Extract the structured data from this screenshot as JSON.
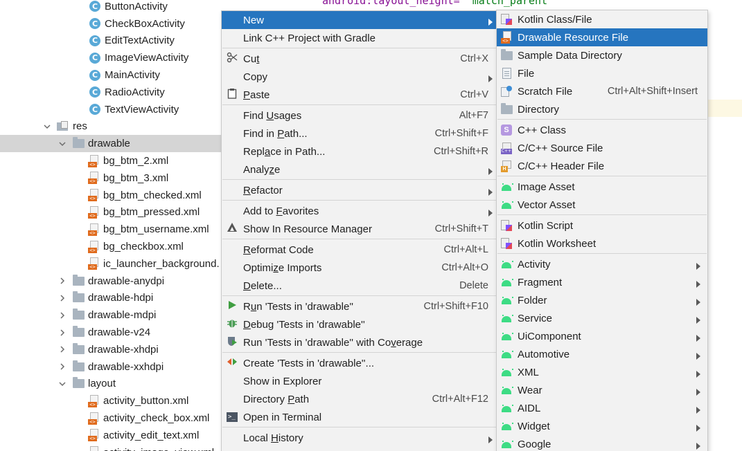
{
  "editor": {
    "code_attr": "android:layout_height=",
    "code_value": "\"match_parent\""
  },
  "tree": {
    "rows": [
      {
        "label": "ButtonActivity",
        "icon": "class-icon",
        "indent": 130,
        "arrow": ""
      },
      {
        "label": "CheckBoxActivity",
        "icon": "class-icon",
        "indent": 130,
        "arrow": ""
      },
      {
        "label": "EditTextActivity",
        "icon": "class-icon",
        "indent": 130,
        "arrow": ""
      },
      {
        "label": "ImageViewActivity",
        "icon": "class-icon",
        "indent": 130,
        "arrow": ""
      },
      {
        "label": "MainActivity",
        "icon": "class-icon",
        "indent": 130,
        "arrow": ""
      },
      {
        "label": "RadioActivity",
        "icon": "class-icon",
        "indent": 130,
        "arrow": ""
      },
      {
        "label": "TextViewActivity",
        "icon": "class-icon",
        "indent": 130,
        "arrow": ""
      },
      {
        "label": "res",
        "icon": "res-folder-icon",
        "indent": 84,
        "arrow": "down"
      },
      {
        "label": "drawable",
        "icon": "folder-icon",
        "indent": 106,
        "arrow": "down",
        "selected": true
      },
      {
        "label": "bg_btm_2.xml",
        "icon": "xml-file-icon",
        "indent": 128,
        "arrow": ""
      },
      {
        "label": "bg_btm_3.xml",
        "icon": "xml-file-icon",
        "indent": 128,
        "arrow": ""
      },
      {
        "label": "bg_btm_checked.xml",
        "icon": "xml-file-icon",
        "indent": 128,
        "arrow": ""
      },
      {
        "label": "bg_btm_pressed.xml",
        "icon": "xml-file-icon",
        "indent": 128,
        "arrow": ""
      },
      {
        "label": "bg_btm_username.xml",
        "icon": "xml-file-icon",
        "indent": 128,
        "arrow": ""
      },
      {
        "label": "bg_checkbox.xml",
        "icon": "xml-file-icon",
        "indent": 128,
        "arrow": ""
      },
      {
        "label": "ic_launcher_background.",
        "icon": "xml-file-icon",
        "indent": 128,
        "arrow": ""
      },
      {
        "label": "drawable-anydpi",
        "icon": "folder-icon",
        "indent": 106,
        "arrow": "right"
      },
      {
        "label": "drawable-hdpi",
        "icon": "folder-icon",
        "indent": 106,
        "arrow": "right"
      },
      {
        "label": "drawable-mdpi",
        "icon": "folder-icon",
        "indent": 106,
        "arrow": "right"
      },
      {
        "label": "drawable-v24",
        "icon": "folder-icon",
        "indent": 106,
        "arrow": "right"
      },
      {
        "label": "drawable-xhdpi",
        "icon": "folder-icon",
        "indent": 106,
        "arrow": "right"
      },
      {
        "label": "drawable-xxhdpi",
        "icon": "folder-icon",
        "indent": 106,
        "arrow": "right"
      },
      {
        "label": "layout",
        "icon": "folder-icon",
        "indent": 106,
        "arrow": "down"
      },
      {
        "label": "activity_button.xml",
        "icon": "xml-file-icon",
        "indent": 128,
        "arrow": ""
      },
      {
        "label": "activity_check_box.xml",
        "icon": "xml-file-icon",
        "indent": 128,
        "arrow": ""
      },
      {
        "label": "activity_edit_text.xml",
        "icon": "xml-file-icon",
        "indent": 128,
        "arrow": ""
      },
      {
        "label": "activity_image_view.xml",
        "icon": "xml-file-icon",
        "indent": 128,
        "arrow": ""
      }
    ]
  },
  "context_menu": {
    "items": [
      {
        "label": "New",
        "mnemonic": "",
        "shortcut": "",
        "submenu": true,
        "highlighted": true,
        "icon": ""
      },
      {
        "label": "Link C++ Project with Gradle",
        "mnemonic": "",
        "shortcut": "",
        "icon": ""
      },
      {
        "sep": true
      },
      {
        "label": "Cut",
        "mnemonic": "t",
        "shortcut": "Ctrl+X",
        "icon": "scissors-icon"
      },
      {
        "label": "Copy",
        "mnemonic": "",
        "shortcut": "",
        "submenu": true,
        "icon": ""
      },
      {
        "label": "Paste",
        "mnemonic": "P",
        "shortcut": "Ctrl+V",
        "icon": "clipboard-icon"
      },
      {
        "sep": true
      },
      {
        "label": "Find Usages",
        "mnemonic": "U",
        "shortcut": "Alt+F7",
        "icon": ""
      },
      {
        "label": "Find in Path...",
        "mnemonic": "P",
        "shortcut": "Ctrl+Shift+F",
        "icon": ""
      },
      {
        "label": "Replace in Path...",
        "mnemonic": "a",
        "shortcut": "Ctrl+Shift+R",
        "icon": ""
      },
      {
        "label": "Analyze",
        "mnemonic": "z",
        "shortcut": "",
        "submenu": true,
        "icon": ""
      },
      {
        "sep": true
      },
      {
        "label": "Refactor",
        "mnemonic": "R",
        "shortcut": "",
        "submenu": true,
        "icon": ""
      },
      {
        "sep": true
      },
      {
        "label": "Add to Favorites",
        "mnemonic": "F",
        "shortcut": "",
        "submenu": true,
        "icon": ""
      },
      {
        "label": "Show In Resource Manager",
        "mnemonic": "",
        "shortcut": "Ctrl+Shift+T",
        "icon": "resource-manager-icon"
      },
      {
        "sep": true
      },
      {
        "label": "Reformat Code",
        "mnemonic": "R",
        "shortcut": "Ctrl+Alt+L",
        "icon": ""
      },
      {
        "label": "Optimize Imports",
        "mnemonic": "z",
        "shortcut": "Ctrl+Alt+O",
        "icon": ""
      },
      {
        "label": "Delete...",
        "mnemonic": "D",
        "shortcut": "Delete",
        "icon": ""
      },
      {
        "sep": true
      },
      {
        "label": "Run 'Tests in 'drawable''",
        "mnemonic": "u",
        "shortcut": "Ctrl+Shift+F10",
        "icon": "run-icon"
      },
      {
        "label": "Debug 'Tests in 'drawable''",
        "mnemonic": "D",
        "shortcut": "",
        "icon": "debug-icon"
      },
      {
        "label": "Run 'Tests in 'drawable'' with Coverage",
        "mnemonic": "v",
        "shortcut": "",
        "icon": "coverage-icon"
      },
      {
        "sep": true
      },
      {
        "label": "Create 'Tests in 'drawable''...",
        "mnemonic": "",
        "shortcut": "",
        "icon": "create-test-icon"
      },
      {
        "label": "Show in Explorer",
        "mnemonic": "",
        "shortcut": "",
        "icon": ""
      },
      {
        "label": "Directory Path",
        "mnemonic": "P",
        "shortcut": "Ctrl+Alt+F12",
        "icon": ""
      },
      {
        "label": "Open in Terminal",
        "mnemonic": "",
        "shortcut": "",
        "icon": "terminal-icon"
      },
      {
        "sep": true
      },
      {
        "label": "Local History",
        "mnemonic": "H",
        "shortcut": "",
        "submenu": true,
        "icon": ""
      }
    ]
  },
  "new_submenu": {
    "items": [
      {
        "label": "Kotlin Class/File",
        "icon": "kotlin-file-icon",
        "shortcut": ""
      },
      {
        "label": "Drawable Resource File",
        "icon": "xml-file-icon",
        "shortcut": "",
        "highlighted": true
      },
      {
        "label": "Sample Data Directory",
        "icon": "folder-icon",
        "shortcut": ""
      },
      {
        "label": "File",
        "icon": "file-icon",
        "shortcut": ""
      },
      {
        "label": "Scratch File",
        "icon": "scratch-file-icon",
        "shortcut": "Ctrl+Alt+Shift+Insert"
      },
      {
        "label": "Directory",
        "icon": "folder-icon",
        "shortcut": ""
      },
      {
        "sep": true
      },
      {
        "label": "C++ Class",
        "icon": "cpp-class-icon",
        "shortcut": ""
      },
      {
        "label": "C/C++ Source File",
        "icon": "cpp-source-icon",
        "shortcut": ""
      },
      {
        "label": "C/C++ Header File",
        "icon": "cpp-header-icon",
        "shortcut": ""
      },
      {
        "sep": true
      },
      {
        "label": "Image Asset",
        "icon": "android-icon",
        "shortcut": ""
      },
      {
        "label": "Vector Asset",
        "icon": "android-icon",
        "shortcut": ""
      },
      {
        "sep": true
      },
      {
        "label": "Kotlin Script",
        "icon": "kotlin-script-icon",
        "shortcut": ""
      },
      {
        "label": "Kotlin Worksheet",
        "icon": "kotlin-script-icon",
        "shortcut": ""
      },
      {
        "sep": true
      },
      {
        "label": "Activity",
        "icon": "android-icon",
        "submenu": true
      },
      {
        "label": "Fragment",
        "icon": "android-icon",
        "submenu": true
      },
      {
        "label": "Folder",
        "icon": "android-icon",
        "submenu": true
      },
      {
        "label": "Service",
        "icon": "android-icon",
        "submenu": true
      },
      {
        "label": "UiComponent",
        "icon": "android-icon",
        "submenu": true
      },
      {
        "label": "Automotive",
        "icon": "android-icon",
        "submenu": true
      },
      {
        "label": "XML",
        "icon": "android-icon",
        "submenu": true
      },
      {
        "label": "Wear",
        "icon": "android-icon",
        "submenu": true
      },
      {
        "label": "AIDL",
        "icon": "android-icon",
        "submenu": true
      },
      {
        "label": "Widget",
        "icon": "android-icon",
        "submenu": true
      },
      {
        "label": "Google",
        "icon": "android-icon",
        "submenu": true
      }
    ]
  },
  "colors": {
    "highlight": "#2675bf",
    "tree_selection": "#d5d5d5"
  }
}
